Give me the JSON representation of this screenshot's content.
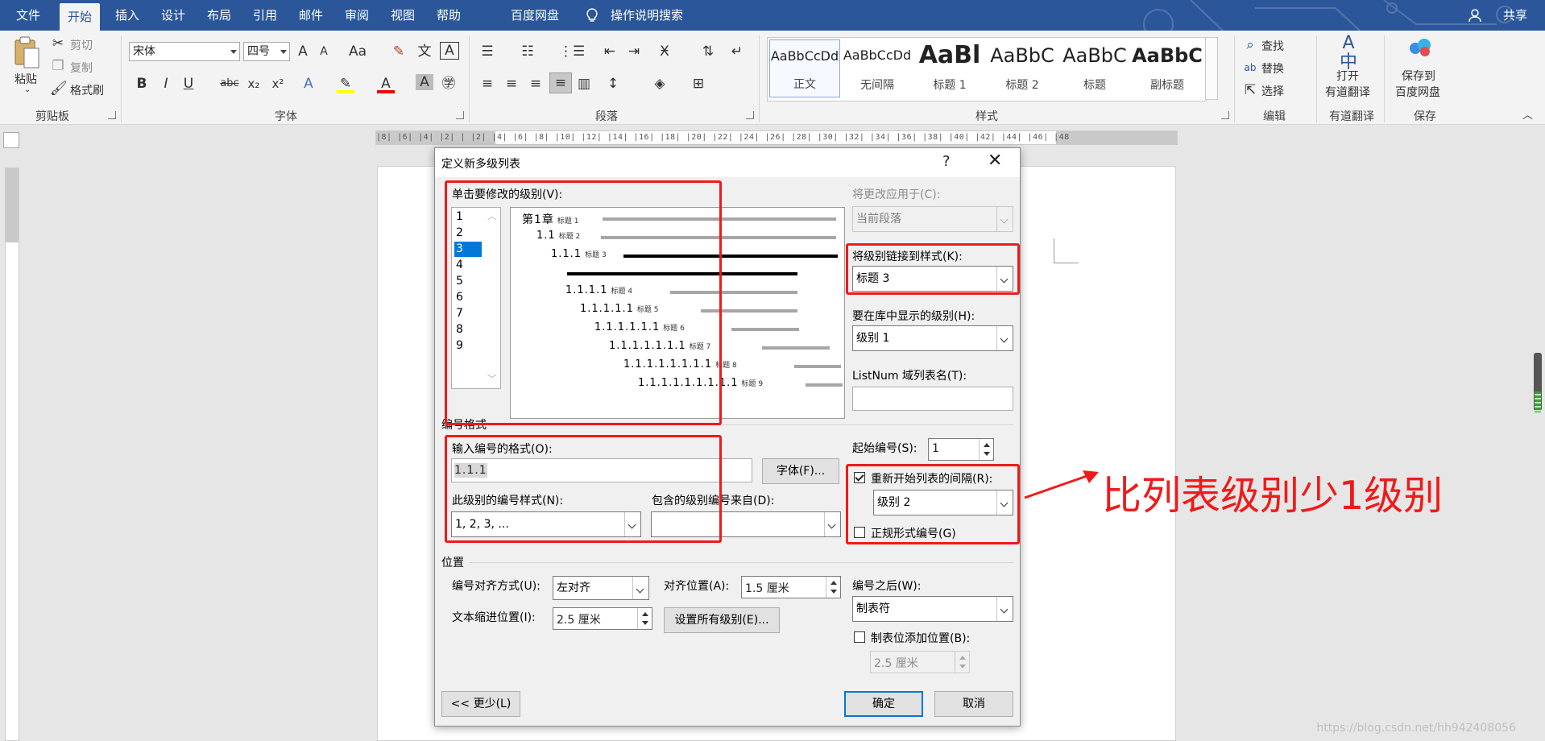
{
  "menubar": {
    "tabs": [
      "文件",
      "开始",
      "插入",
      "设计",
      "布局",
      "引用",
      "邮件",
      "审阅",
      "视图",
      "帮助",
      "百度网盘",
      "操作说明搜索"
    ],
    "share": "共享"
  },
  "ribbon": {
    "clipboard": {
      "paste": "粘贴",
      "cut": "剪切",
      "copy": "复制",
      "format_painter": "格式刷",
      "label": "剪贴板"
    },
    "font": {
      "name": "宋体",
      "size": "四号",
      "label": "字体",
      "aa": "Aa",
      "grow": "A",
      "shrink": "A",
      "wen": "文",
      "bold": "B",
      "italic": "I",
      "underline": "U",
      "strike": "abc",
      "sub": "x₂",
      "sup": "x²"
    },
    "paragraph": {
      "label": "段落"
    },
    "styles": {
      "label": "样式",
      "items": [
        {
          "sample": "AaBbCcDd",
          "name": "正文"
        },
        {
          "sample": "AaBbCcDd",
          "name": "无间隔"
        },
        {
          "sample": "AaBl",
          "name": "标题 1"
        },
        {
          "sample": "AaBbC",
          "name": "标题 2"
        },
        {
          "sample": "AaBbC",
          "name": "标题"
        },
        {
          "sample": "AaBbC",
          "name": "副标题"
        }
      ]
    },
    "editing": {
      "find": "查找",
      "replace": "替换",
      "select": "选择",
      "label": "编辑"
    },
    "youdao": {
      "line1": "打开",
      "line2": "有道翻译",
      "label": "有道翻译"
    },
    "baidu": {
      "line1": "保存到",
      "line2": "百度网盘",
      "label": "保存"
    }
  },
  "ruler_text": "|8| |6| |4| |2| |  |2| |4| |6| |8| |10| |12| |14| |16| |18| |20| |22| |24| |26| |28| |30| |32| |34| |36| |38| |40| |42| |44| |46| |48",
  "dialog": {
    "title": "定义新多级列表",
    "help": "?",
    "close": "✕",
    "click_level_label": "单击要修改的级别(V):",
    "levels": [
      "1",
      "2",
      "3",
      "4",
      "5",
      "6",
      "7",
      "8",
      "9"
    ],
    "selected_level": 3,
    "preview_rows": [
      {
        "num": "第1章",
        "tag": "标题 1"
      },
      {
        "num": "1.1",
        "tag": "标题 2"
      },
      {
        "num": "1.1.1",
        "tag": "标题 3"
      },
      {
        "num": "1.1.1.1",
        "tag": "标题 4"
      },
      {
        "num": "1.1.1.1.1",
        "tag": "标题 5"
      },
      {
        "num": "1.1.1.1.1.1",
        "tag": "标题 6"
      },
      {
        "num": "1.1.1.1.1.1.1",
        "tag": "标题 7"
      },
      {
        "num": "1.1.1.1.1.1.1.1",
        "tag": "标题 8"
      },
      {
        "num": "1.1.1.1.1.1.1.1.1",
        "tag": "标题 9"
      }
    ],
    "apply_to_label": "将更改应用于(C):",
    "apply_to_value": "当前段落",
    "link_style_label": "将级别链接到样式(K):",
    "link_style_value": "标题 3",
    "gallery_level_label": "要在库中显示的级别(H):",
    "gallery_level_value": "级别 1",
    "listnum_label": "ListNum 域列表名(T):",
    "listnum_value": "",
    "number_format_section": "编号格式",
    "enter_format_label": "输入编号的格式(O):",
    "enter_format_value": "1.1.1",
    "font_button": "字体(F)...",
    "number_style_label": "此级别的编号样式(N):",
    "number_style_value": "1, 2, 3, ...",
    "include_from_label": "包含的级别编号来自(D):",
    "include_from_value": "",
    "start_at_label": "起始编号(S):",
    "start_at_value": "1",
    "restart_label": "重新开始列表的间隔(R):",
    "restart_value": "级别 2",
    "restart_checked": true,
    "legal_label": "正规形式编号(G)",
    "legal_checked": false,
    "position_section": "位置",
    "align_label": "编号对齐方式(U):",
    "align_value": "左对齐",
    "align_at_label": "对齐位置(A):",
    "align_at_value": "1.5 厘米",
    "indent_label": "文本缩进位置(I):",
    "indent_value": "2.5 厘米",
    "set_all_button": "设置所有级别(E)...",
    "follow_label": "编号之后(W):",
    "follow_value": "制表符",
    "tab_add_label": "制表位添加位置(B):",
    "tab_add_checked": false,
    "tab_add_value": "2.5 厘米",
    "less_button": "<< 更少(L)",
    "ok_button": "确定",
    "cancel_button": "取消"
  },
  "annotation": "比列表级别少1级别",
  "watermark": "https://blog.csdn.net/hh942408056",
  "colors": {
    "accent": "#2b579a",
    "annotation_red": "#f01a1a",
    "selection": "#0078d7"
  }
}
